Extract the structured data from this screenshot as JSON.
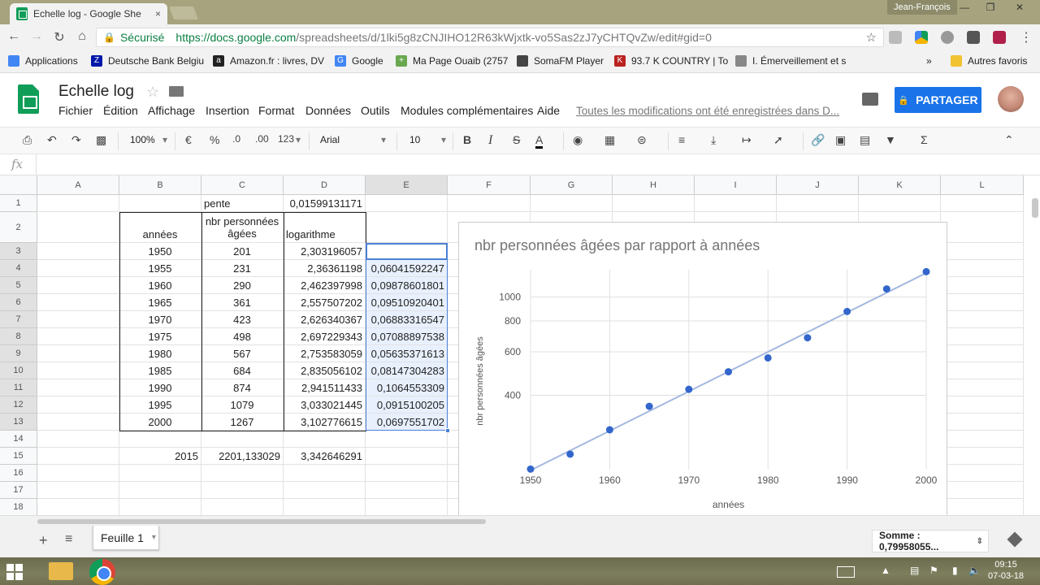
{
  "browser": {
    "tab_title": "Echelle log - Google She",
    "tab_close": "×",
    "user": "Jean-François",
    "secure_label": "Sécurisé",
    "url_main": "https://docs.google.com",
    "url_rest": "/spreadsheets/d/1lki5g8zCNJIHO12R63kWjxtk-vo5Sas2zJ7yCHTQvZw/edit#gid=0",
    "bookmarks": [
      {
        "label": "Applications",
        "icon": "apps-icon"
      },
      {
        "label": "Deutsche Bank Belgiu",
        "icon": "deutsche-bank-icon"
      },
      {
        "label": "Amazon.fr : livres, DV",
        "icon": "amazon-icon"
      },
      {
        "label": "Google",
        "icon": "google-icon"
      },
      {
        "label": "Ma Page Ouaib (2757",
        "icon": "plus-icon"
      },
      {
        "label": "SomaFM Player",
        "icon": "somafm-icon"
      },
      {
        "label": "93.7 K COUNTRY | To",
        "icon": "k-country-icon"
      },
      {
        "label": "I. Émerveillement et s",
        "icon": "page-icon"
      }
    ],
    "bookmarks_more": "»",
    "other_bookmarks": "Autres favoris"
  },
  "doc": {
    "title": "Echelle log",
    "menus": [
      "Fichier",
      "Édition",
      "Affichage",
      "Insertion",
      "Format",
      "Données",
      "Outils",
      "Modules complémentaires",
      "Aide"
    ],
    "saved_status": "Toutes les modifications ont été enregistrées dans D...",
    "share_label": "PARTAGER"
  },
  "toolbar": {
    "zoom": "100%",
    "currency": "€",
    "percent": "%",
    "dec_less": ".0",
    "dec_more": ".00",
    "more_formats": "123",
    "font": "Arial",
    "font_size": "10",
    "bold": "B",
    "italic": "I",
    "strike": "S",
    "text_color_glyph": "A",
    "sum": "Σ"
  },
  "formula_bar": {
    "fx": "fx",
    "value": ""
  },
  "columns": [
    "A",
    "B",
    "C",
    "D",
    "E",
    "F",
    "G",
    "H",
    "I",
    "J",
    "K",
    "L"
  ],
  "rows": [
    {
      "n": "1",
      "B": "",
      "C": "pente",
      "D": "0,01599131171",
      "E": ""
    },
    {
      "n": "2",
      "B": "années",
      "C": "nbr personnées âgées",
      "D": "logarithme",
      "E": ""
    },
    {
      "n": "3",
      "B": "1950",
      "C": "201",
      "D": "2,303196057",
      "E": ""
    },
    {
      "n": "4",
      "B": "1955",
      "C": "231",
      "D": "2,36361198",
      "E": "0,06041592247"
    },
    {
      "n": "5",
      "B": "1960",
      "C": "290",
      "D": "2,462397998",
      "E": "0,09878601801"
    },
    {
      "n": "6",
      "B": "1965",
      "C": "361",
      "D": "2,557507202",
      "E": "0,09510920401"
    },
    {
      "n": "7",
      "B": "1970",
      "C": "423",
      "D": "2,626340367",
      "E": "0,06883316547"
    },
    {
      "n": "8",
      "B": "1975",
      "C": "498",
      "D": "2,697229343",
      "E": "0,07088897538"
    },
    {
      "n": "9",
      "B": "1980",
      "C": "567",
      "D": "2,753583059",
      "E": "0,05635371613"
    },
    {
      "n": "10",
      "B": "1985",
      "C": "684",
      "D": "2,835056102",
      "E": "0,08147304283"
    },
    {
      "n": "11",
      "B": "1990",
      "C": "874",
      "D": "2,941511433",
      "E": "0,1064553309"
    },
    {
      "n": "12",
      "B": "1995",
      "C": "1079",
      "D": "3,033021445",
      "E": "0,0915100​205"
    },
    {
      "n": "13",
      "B": "2000",
      "C": "1267",
      "D": "3,102776615",
      "E": "0,0697551702"
    },
    {
      "n": "14",
      "B": "",
      "C": "",
      "D": "",
      "E": ""
    },
    {
      "n": "15",
      "B": "2015",
      "C": "2201,133029",
      "D": "3,342646291",
      "E": ""
    },
    {
      "n": "16",
      "B": "",
      "C": "",
      "D": "",
      "E": ""
    },
    {
      "n": "17",
      "B": "",
      "C": "",
      "D": "",
      "E": ""
    },
    {
      "n": "18",
      "B": "",
      "C": "",
      "D": "",
      "E": ""
    }
  ],
  "chart_data": {
    "type": "scatter",
    "title": "nbr personnées âgées par rapport à années",
    "xlabel": "années",
    "ylabel": "nbr personnées âgées",
    "y_scale": "log",
    "trendline": true,
    "x_ticks": [
      1950,
      1960,
      1970,
      1980,
      1990,
      2000
    ],
    "y_ticks": [
      400,
      600,
      800,
      1000
    ],
    "xlim": [
      1950,
      2000
    ],
    "ylim": [
      200,
      1290
    ],
    "series": [
      {
        "x": [
          1950,
          1955,
          1960,
          1965,
          1970,
          1975,
          1980,
          1985,
          1990,
          1995,
          2000
        ],
        "y": [
          201,
          231,
          290,
          361,
          423,
          498,
          567,
          684,
          874,
          1079,
          1267
        ]
      }
    ],
    "point_color": "#3366cc",
    "line_color": "#a4b9e0"
  },
  "sheets": {
    "tab": "Feuille 1",
    "sum": "Somme : 0,79958055..."
  },
  "taskbar": {
    "time": "09:15",
    "date": "07-03-18"
  }
}
